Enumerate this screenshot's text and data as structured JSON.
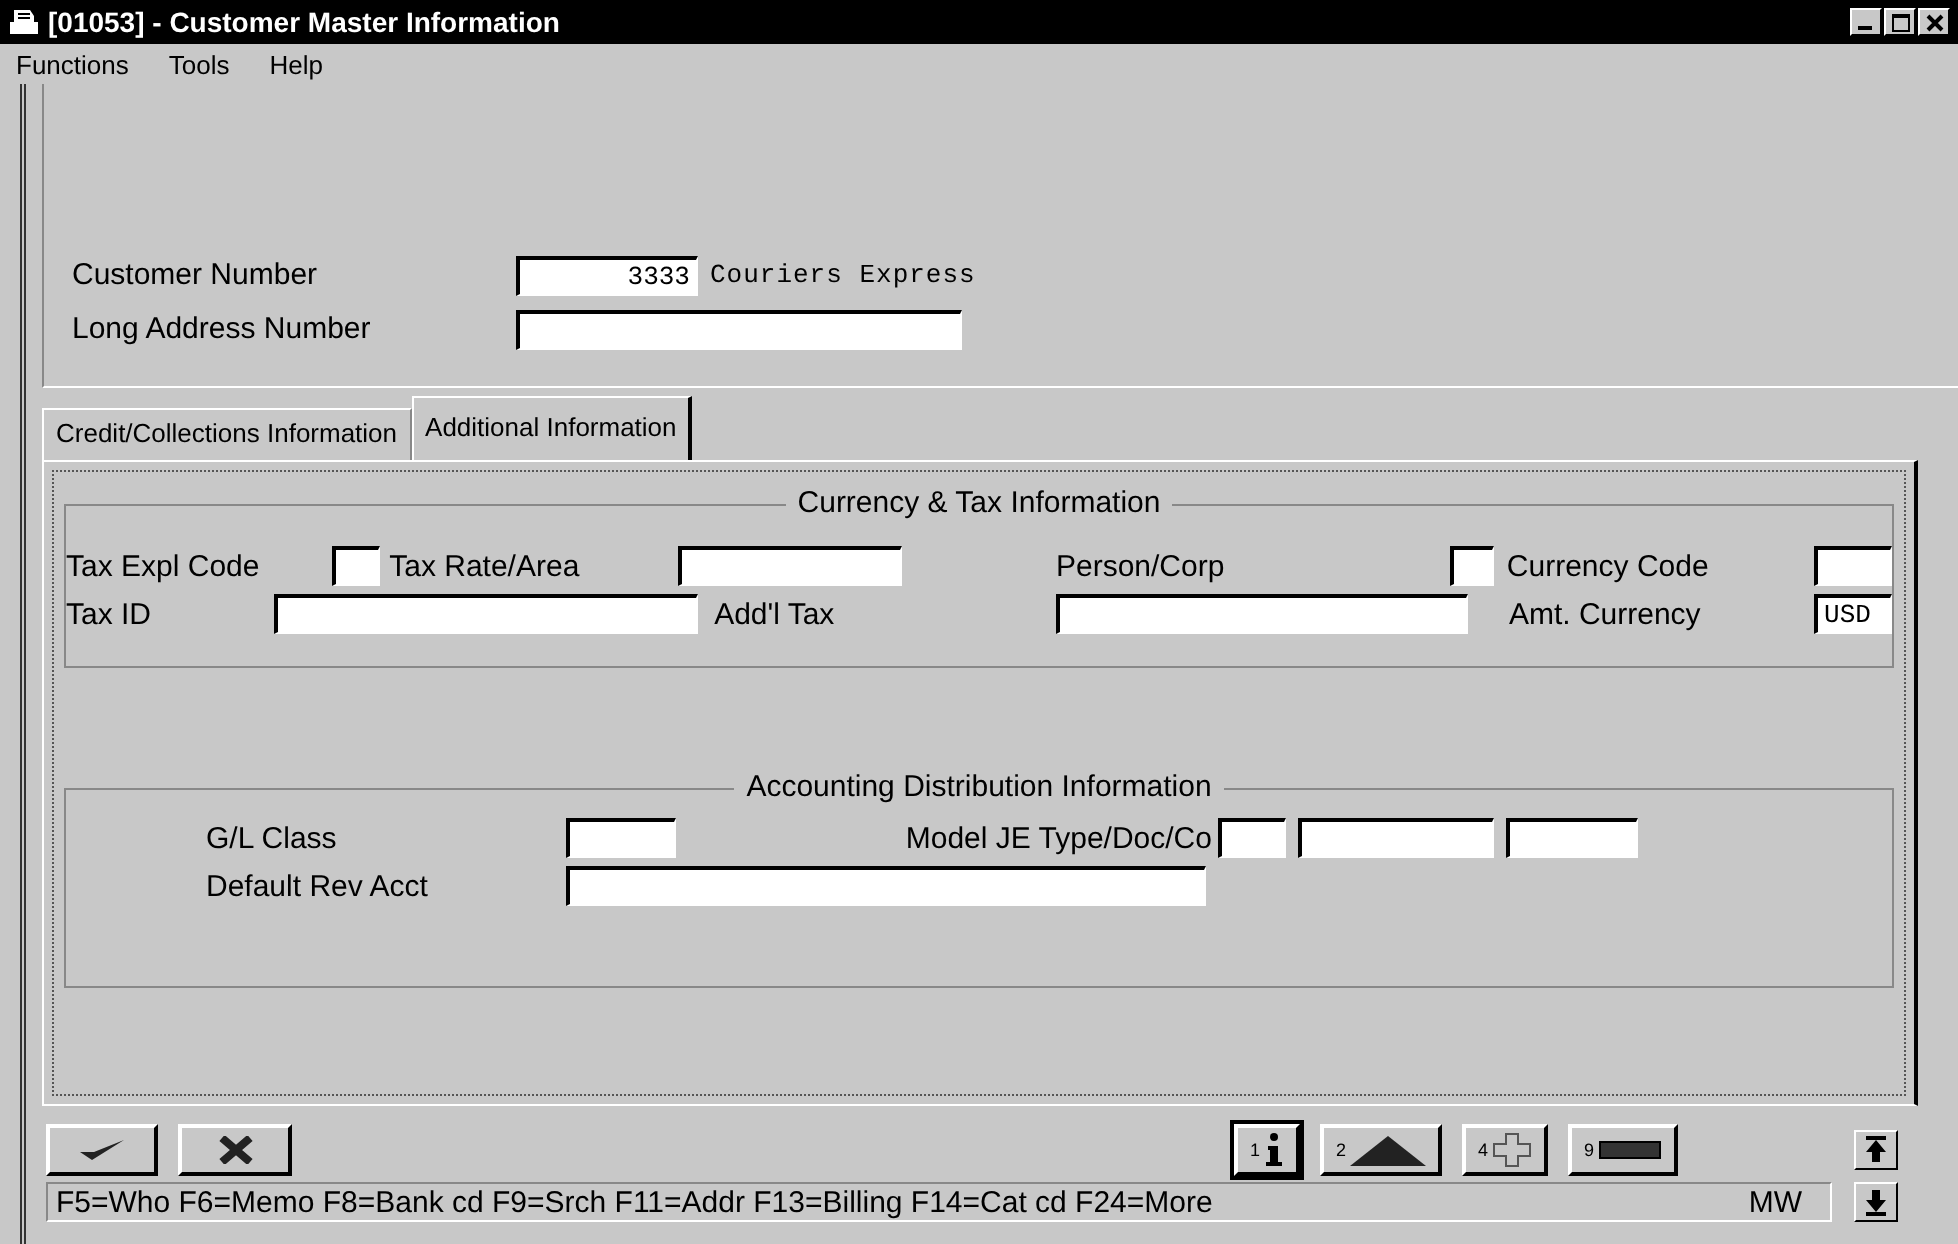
{
  "window": {
    "title": "[01053] - Customer Master Information"
  },
  "menu": [
    "Functions",
    "Tools",
    "Help"
  ],
  "header": {
    "customer_number": {
      "label": "Customer Number",
      "value": "3333",
      "description": "Couriers Express"
    },
    "long_address_number": {
      "label": "Long Address Number"
    }
  },
  "tabs": [
    {
      "label": "Credit/Collections Information",
      "selected": false
    },
    {
      "label": "Additional Information",
      "selected": true
    }
  ],
  "currency_tax": {
    "title": "Currency & Tax Information",
    "tax_expl_code": {
      "label": "Tax Expl Code"
    },
    "tax_rate_area": {
      "label": "Tax Rate/Area"
    },
    "person_corp": {
      "label": "Person/Corp"
    },
    "currency_code": {
      "label": "Currency Code"
    },
    "tax_id": {
      "label": "Tax ID"
    },
    "addl_tax": {
      "label": "Add'l Tax"
    },
    "amt_currency": {
      "label": "Amt. Currency",
      "value": "USD"
    }
  },
  "accounting": {
    "title": "Accounting Distribution Information",
    "gl_class": {
      "label": "G/L Class"
    },
    "model_je": {
      "label": "Model JE Type/Doc/Co"
    },
    "default_rev_acct": {
      "label": "Default Rev Acct"
    }
  },
  "toolbar": {
    "numbered_buttons": [
      {
        "number": "1",
        "kind": "info",
        "selected": true
      },
      {
        "number": "2",
        "kind": "triangle",
        "selected": false
      },
      {
        "number": "4",
        "kind": "plus",
        "selected": false
      },
      {
        "number": "9",
        "kind": "minus",
        "selected": false
      }
    ]
  },
  "status_bar": {
    "keys": "F5=Who F6=Memo F8=Bank cd F9=Srch F11=Addr F13=Billing F14=Cat cd F24=More",
    "user": "MW"
  }
}
